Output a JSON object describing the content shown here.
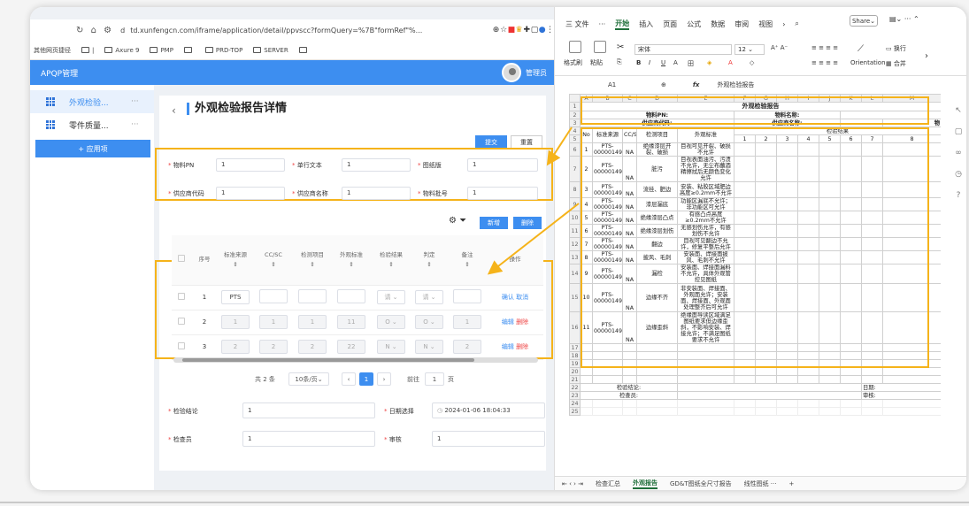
{
  "browser": {
    "url_prefix": "d",
    "url": "td.xunfengcn.com/iframe/application/detail/ppvscc?formQuery=%7B\"formRef\"%...",
    "bookmarks": [
      "其他网页捷径",
      "|",
      "Axure 9",
      "PMP",
      "",
      "PRD-TOP",
      "SERVER",
      ""
    ]
  },
  "app": {
    "title": "APQP管理",
    "admin": "管理员",
    "sidebar": [
      {
        "label": "外观检验...",
        "more": "···"
      },
      {
        "label": "零件质量...",
        "more": "···"
      }
    ],
    "add_app": "+ 应用项",
    "page_title": "外观检验报告详情",
    "back": "‹",
    "submit": "提交",
    "reset": "重置",
    "form": {
      "material_pn_label": "物料PN",
      "material_pn": "1",
      "single_text_label": "单行文本",
      "single_text": "1",
      "drawing_ver_label": "图纸版",
      "drawing_ver": "1",
      "supplier_code_label": "供应商代码",
      "supplier_code": "1",
      "supplier_name_label": "供应商名称",
      "supplier_name": "1",
      "batch_label": "物料批号",
      "batch": "1"
    },
    "new_btn": "新增",
    "del_btn": "删除",
    "table": {
      "headers": [
        "",
        "序号",
        "标准来源",
        "CC/SC",
        "检测项目",
        "外观标准",
        "检验结果",
        "判定",
        "备注",
        "操作"
      ],
      "rows": [
        {
          "no": "1",
          "src": "PTS",
          "cc": "",
          "item": "",
          "std": "",
          "res": "请",
          "judge": "请",
          "note": "",
          "a1": "确认",
          "a2": "取消"
        },
        {
          "no": "2",
          "src": "1",
          "cc": "1",
          "item": "1",
          "std": "11",
          "res": "O",
          "judge": "O",
          "note": "1",
          "a1": "编辑",
          "a2": "删除"
        },
        {
          "no": "3",
          "src": "2",
          "cc": "2",
          "item": "2",
          "std": "22",
          "res": "N",
          "judge": "N",
          "note": "2",
          "a1": "编辑",
          "a2": "删除"
        }
      ]
    },
    "pager": {
      "total": "共 2 条",
      "per_page": "10条/页",
      "current": "1",
      "goto_label": "前往",
      "goto_value": "1",
      "page_suffix": "页"
    },
    "bottom_form": {
      "conclusion_label": "检验结论",
      "conclusion": "1",
      "date_label": "日期选择",
      "date": "2024-01-06 18:04:33",
      "inspector_label": "检查员",
      "inspector": "1",
      "review_label": "审核",
      "review": "1"
    }
  },
  "sheet": {
    "menu": [
      "三 文件",
      "···",
      "开始",
      "插入",
      "页面",
      "公式",
      "数据",
      "审阅",
      "视图"
    ],
    "share": "Share",
    "font": "宋体",
    "size": "12",
    "ribbon_labels": {
      "format_painter": "格式刷",
      "paste": "粘贴",
      "wrap": "换行",
      "orientation": "Orientation",
      "merge": "合并"
    },
    "cell_ref": "A1",
    "fx": "fx",
    "formula": "外观检验报告",
    "col_headers": [
      "",
      "A",
      "B",
      "C",
      "D",
      "E",
      "F",
      "G",
      "H",
      "I",
      "J",
      "K",
      "L",
      "M"
    ],
    "title": "外观检验报告",
    "r2": {
      "a": "物料PN:",
      "b": "物料名称:"
    },
    "r3": {
      "a": "供应商代码:",
      "b": "供应商名称:",
      "c": "物"
    },
    "r4_h": [
      "No",
      "标准来源",
      "CC/SC",
      "检测项目",
      "外观标准",
      "检验结果"
    ],
    "r5_nums": [
      "1",
      "2",
      "3",
      "4",
      "5",
      "6",
      "7",
      "8",
      "9"
    ],
    "rows": [
      {
        "rn": "6",
        "no": "1",
        "src": "PTS-00000149",
        "cc": "NA",
        "item": "绝缘漆层开裂、破损",
        "std": "目视可见开裂、破损不允许"
      },
      {
        "rn": "7",
        "no": "2",
        "src": "PTS-00000149",
        "cc": "NA",
        "item": "脏污",
        "std": "目视表面油污、污渍不允许，无尘布蘸酒精擦拭后无颜色变化允许"
      },
      {
        "rn": "8",
        "no": "3",
        "src": "PTS-00000149",
        "cc": "NA",
        "item": "流挂、肥边",
        "std": "安装、粘胶区域肥边高度≥0.2mm不允许"
      },
      {
        "rn": "9",
        "no": "4",
        "src": "PTS-00000149",
        "cc": "NA",
        "item": "漆层漏底",
        "std": "功能区漏底不允许；非功能区可允许"
      },
      {
        "rn": "10",
        "no": "5",
        "src": "PTS-00000149",
        "cc": "NA",
        "item": "绝缘漆层凸点",
        "std": "有感凸点高度≥0.2mm不允许"
      },
      {
        "rn": "11",
        "no": "6",
        "src": "PTS-00000149",
        "cc": "NA",
        "item": "绝缘漆层划伤",
        "std": "无感划伤允许，有感划伤不允许"
      },
      {
        "rn": "12",
        "no": "7",
        "src": "PTS-00000149",
        "cc": "NA",
        "item": "翻边",
        "std": "目视可见翻边不允许，修复平整后允许"
      },
      {
        "rn": "13",
        "no": "8",
        "src": "PTS-00000149",
        "cc": "NA",
        "item": "披风、毛刺",
        "std": "安装面、焊接面披风、毛刺不允许"
      },
      {
        "rn": "14",
        "no": "9",
        "src": "PTS-00000149",
        "cc": "NA",
        "item": "漏检",
        "std": "安装面、焊接面漏料不允许，具体外观管控见图纸"
      },
      {
        "rn": "15",
        "no": "10",
        "src": "PTS-00000149",
        "cc": "NA",
        "item": "边缘不齐",
        "std": "非安装面、焊接面、外观面允许；安装面、焊接面、外观面处理整齐后可允许"
      },
      {
        "rn": "16",
        "no": "11",
        "src": "PTS-00000149",
        "cc": "NA",
        "item": "边缘歪斜",
        "std": "绝缘面导读区域满足图纸要求但边缘歪斜，不影响安装、焊接允许；不满足图纸要求不允许"
      }
    ],
    "empty_rows": [
      "17",
      "18",
      "19",
      "20",
      "21"
    ],
    "r22": {
      "rn": "22",
      "a": "检验结论:",
      "b": "日期:"
    },
    "r23": {
      "rn": "23",
      "a": "检查员:",
      "b": "审核:"
    },
    "extra_rows": [
      "24",
      "25"
    ],
    "tabs": [
      "检查汇总",
      "外观报告",
      "GD&T图纸全尺寸报告",
      "线性图纸 ···"
    ]
  }
}
